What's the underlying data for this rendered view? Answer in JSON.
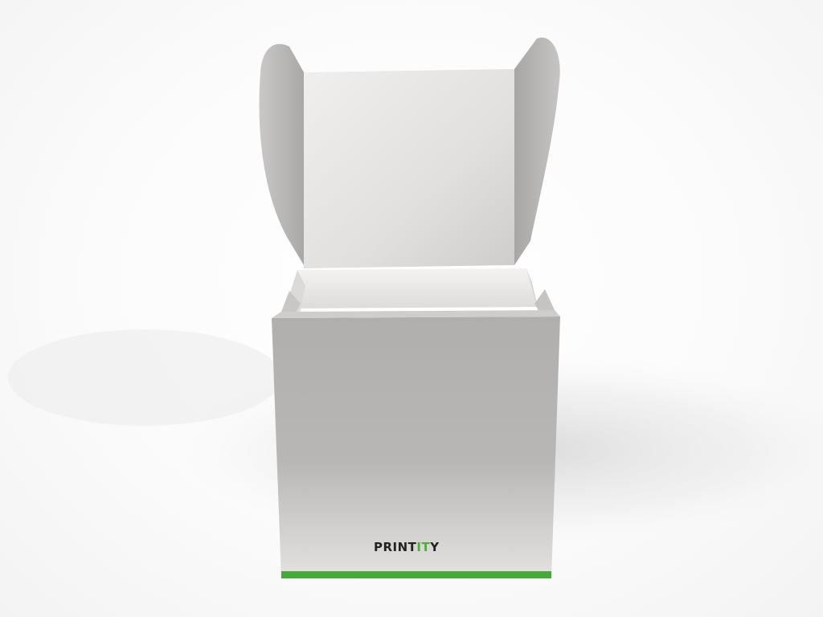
{
  "brand": {
    "logo_part1": "PRINT",
    "logo_part2": "IT",
    "logo_part3": "Y",
    "text_color": "#222222",
    "accent_color": "#4caf3a"
  },
  "colors": {
    "box_face": "#b6b4b2",
    "box_inner": "#e4e2e0",
    "stripe": "#47a83c"
  }
}
